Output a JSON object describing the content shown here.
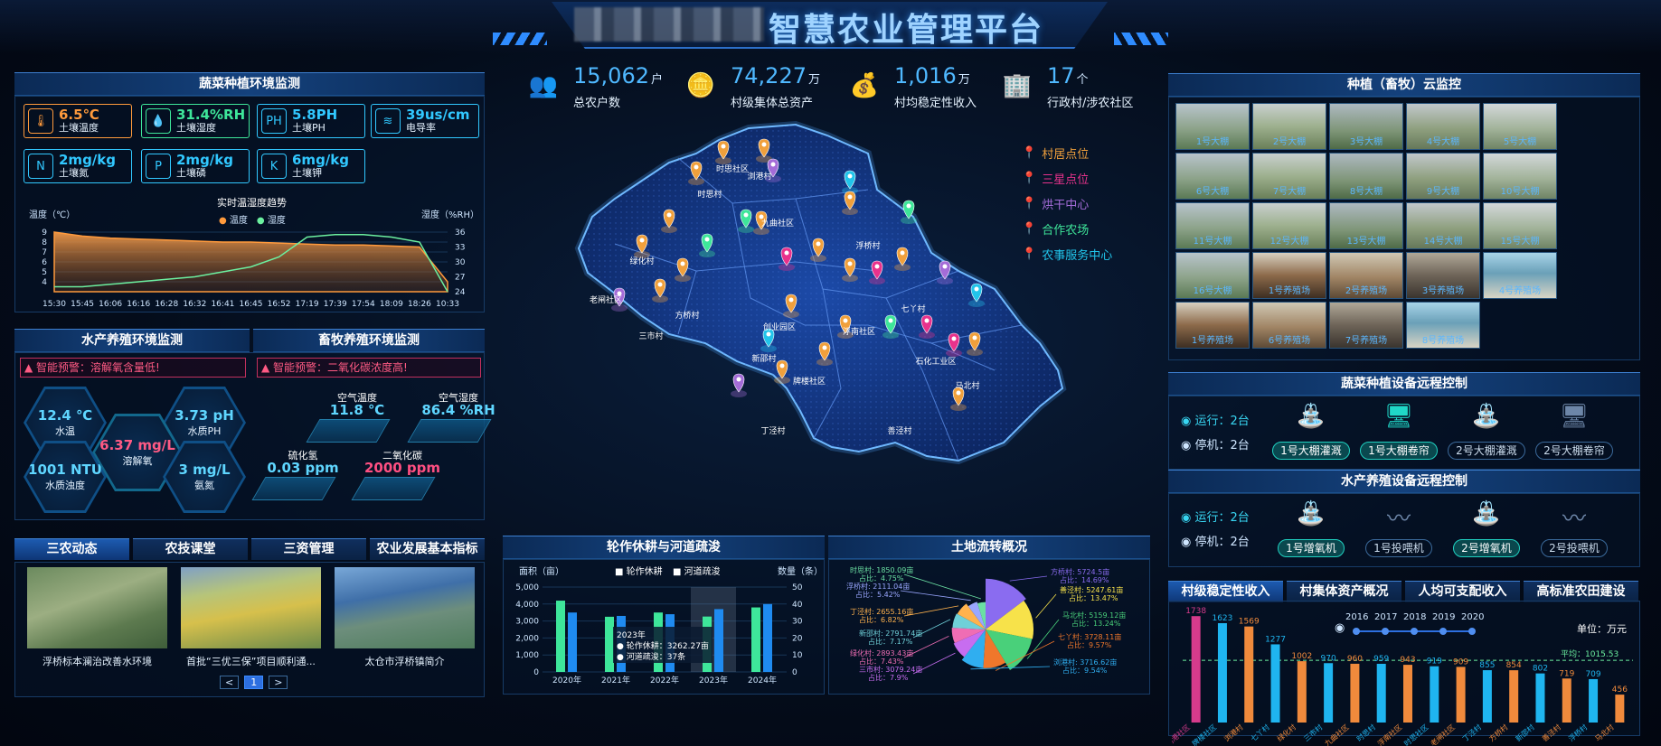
{
  "header": {
    "title": "智慧农业管理平台"
  },
  "stats": [
    {
      "value": "15,062",
      "unit": "户",
      "label": "总农户数",
      "icon": "people-icon",
      "color": "#2d8cf0"
    },
    {
      "value": "74,227",
      "unit": "万",
      "label": "村级集体总资产",
      "icon": "coins-icon",
      "color": "#2d8cf0"
    },
    {
      "value": "1,016",
      "unit": "万",
      "label": "村均稳定性收入",
      "icon": "money-bag-icon",
      "color": "#2d8cf0"
    },
    {
      "value": "17",
      "unit": "个",
      "label": "行政村/涉农社区",
      "icon": "building-icon",
      "color": "#2d8cf0"
    }
  ],
  "veg_env": {
    "title": "蔬菜种植环境监测",
    "sensors": [
      {
        "value": "6.5℃",
        "label": "土壤温度",
        "color": "#ff9a3c"
      },
      {
        "value": "31.4%RH",
        "label": "土壤湿度",
        "color": "#3ee69a"
      },
      {
        "value": "5.8PH",
        "label": "土壤PH",
        "color": "#31c8ff"
      },
      {
        "value": "39us/cm",
        "label": "电导率",
        "color": "#31c8ff"
      },
      {
        "value": "2mg/kg",
        "label": "土壤氮",
        "color": "#31c8ff"
      },
      {
        "value": "2mg/kg",
        "label": "土壤磷",
        "color": "#31c8ff"
      },
      {
        "value": "6mg/kg",
        "label": "土壤钾",
        "color": "#31c8ff"
      }
    ],
    "trend_title": "实时温湿度趋势",
    "temp_axis": "温度（℃）",
    "hum_axis": "湿度（%RH）",
    "legend_temp": "温度",
    "legend_hum": "湿度"
  },
  "aqua_env": {
    "title": "水产养殖环境监测",
    "warning": "智能预警：溶解氧含量低!",
    "items": [
      {
        "value": "12.4 ℃",
        "label": "水温"
      },
      {
        "value": "3.73 pH",
        "label": "水质PH"
      },
      {
        "value": "6.37 mg/L",
        "label": "溶解氧"
      },
      {
        "value": "1001 NTU",
        "label": "水质浊度"
      },
      {
        "value": "3 mg/L",
        "label": "氨氮"
      }
    ]
  },
  "live_env": {
    "title": "畜牧养殖环境监测",
    "warning": "智能预警：二氧化碳浓度高!",
    "items": [
      {
        "label": "空气温度",
        "value": "11.8 ℃"
      },
      {
        "label": "空气湿度",
        "value": "86.4 %RH"
      },
      {
        "label": "硫化氢",
        "value": "0.03 ppm"
      },
      {
        "label": "二氧化碳",
        "value": "2000 ppm"
      }
    ]
  },
  "news": {
    "tabs": [
      "三农动态",
      "农技课堂",
      "三资管理",
      "农业发展基本指标"
    ],
    "items": [
      "浮桥标本澜治改善水环境",
      "首批“三优三保”项目顺利通...",
      "太仓市浮桥镇简介"
    ],
    "pager": {
      "prev": "<",
      "page": "1",
      "next": ">"
    }
  },
  "map": {
    "legend": [
      {
        "label": "村居点位",
        "color": "#f0a03c"
      },
      {
        "label": "三星点位",
        "color": "#e8328c"
      },
      {
        "label": "烘干中心",
        "color": "#a46cd8"
      },
      {
        "label": "合作农场",
        "color": "#3ee69a"
      },
      {
        "label": "农事服务中心",
        "color": "#21c4ea"
      }
    ],
    "places": [
      "浏港村",
      "时思社区",
      "时思村",
      "九曲社区",
      "浮桥村",
      "绿化村",
      "老闸社区",
      "方桥村",
      "三市村",
      "创业园区",
      "浮南社区",
      "七丫村",
      "石化工业区",
      "新邵村",
      "牌楼社区",
      "马北村",
      "丁泾村",
      "善泾村"
    ]
  },
  "monitor": {
    "title": "种植（畜牧）云监控",
    "cams": [
      "1号大棚",
      "2号大棚",
      "3号大棚",
      "4号大棚",
      "5号大棚",
      "6号大棚",
      "7号大棚",
      "8号大棚",
      "9号大棚",
      "10号大棚",
      "11号大棚",
      "12号大棚",
      "13号大棚",
      "14号大棚",
      "15号大棚",
      "16号大棚",
      "1号养殖场",
      "2号养殖场",
      "3号养殖场",
      "4号养殖场",
      "1号养殖场",
      "6号养殖场",
      "7号养殖场",
      "8号养殖场"
    ]
  },
  "veg_ctrl": {
    "title": "蔬菜种植设备远程控制",
    "running": "运行：2台",
    "stopped": "停机：2台",
    "devices": [
      "1号大棚灌溉",
      "1号大棚卷帘",
      "2号大棚灌溉",
      "2号大棚卷帘"
    ]
  },
  "aqua_ctrl": {
    "title": "水产养殖设备远程控制",
    "running": "运行：2台",
    "stopped": "停机：2台",
    "devices": [
      "1号增氧机",
      "1号投喂机",
      "2号增氧机",
      "2号投喂机"
    ]
  },
  "rotation": {
    "title": "轮作休耕与河道疏浚",
    "left_axis": "面积（亩）",
    "right_axis": "数量（条）",
    "legend1": "轮作休耕",
    "legend2": "河道疏浚",
    "tip_year": "2023年",
    "tip1": "● 轮作休耕：3262.27亩",
    "tip2": "● 河道疏浚：37条"
  },
  "land": {
    "title": "土地流转概况"
  },
  "income": {
    "tabs": [
      "村级稳定性收入",
      "村集体资产概况",
      "人均可支配收入",
      "高标准农田建设"
    ],
    "unit": "单位：万元",
    "avg": "平均：1015.53",
    "years": [
      "2016",
      "2017",
      "2018",
      "2019",
      "2020"
    ]
  },
  "chart_data": [
    {
      "type": "area",
      "title": "实时温湿度趋势",
      "x": [
        "15:30",
        "15:45",
        "16:06",
        "16:16",
        "16:28",
        "16:32",
        "16:41",
        "16:45",
        "16:52",
        "17:19",
        "17:39",
        "17:54",
        "18:09",
        "18:26",
        "10:33"
      ],
      "series": [
        {
          "name": "温度",
          "values": [
            9,
            8.6,
            8.4,
            8.3,
            8.2,
            8.1,
            8,
            8,
            7.9,
            7.8,
            7.7,
            7.7,
            7.6,
            7.5,
            4
          ]
        },
        {
          "name": "湿度",
          "values": [
            25,
            25,
            25.5,
            26,
            26.5,
            27,
            28,
            29,
            31,
            35,
            35.5,
            35.5,
            35,
            34,
            24
          ]
        }
      ],
      "ylim": [
        3,
        9
      ],
      "ylim2": [
        24,
        36
      ]
    },
    {
      "type": "bar",
      "title": "轮作休耕与河道疏浚",
      "categories": [
        "2020年",
        "2021年",
        "2022年",
        "2023年",
        "2024年"
      ],
      "series": [
        {
          "name": "轮作休耕",
          "values": [
            4200,
            3250,
            3500,
            3262.27,
            3800
          ]
        },
        {
          "name": "河道疏浚",
          "values": [
            35,
            33,
            34,
            37,
            40
          ]
        }
      ],
      "ylim": [
        0,
        5000
      ],
      "ylim2": [
        0,
        50
      ]
    },
    {
      "type": "pie",
      "title": "土地流转概况",
      "slices": [
        {
          "label": "方桥村: 5724.5亩",
          "pct": "占比：14.69%",
          "value": 14.69,
          "color": "#8a6cf0"
        },
        {
          "label": "善泾村: 5247.61亩",
          "pct": "占比：13.47%",
          "value": 13.47,
          "color": "#f7e24a"
        },
        {
          "label": "马北村: 5159.12亩",
          "pct": "占比：13.24%",
          "value": 13.24,
          "color": "#49d07a"
        },
        {
          "label": "七丫村: 3728.11亩",
          "pct": "占比：9.57%",
          "value": 9.57,
          "color": "#f0772b"
        },
        {
          "label": "浏港村: 3716.62亩",
          "pct": "占比：9.54%",
          "value": 9.54,
          "color": "#30aef0"
        },
        {
          "label": "三市村: 3079.24亩",
          "pct": "占比：7.9%",
          "value": 7.9,
          "color": "#c76df0"
        },
        {
          "label": "绿化村: 2893.43亩",
          "pct": "占比：7.43%",
          "value": 7.43,
          "color": "#ef6db4"
        },
        {
          "label": "新邵村: 2791.74亩",
          "pct": "占比：7.17%",
          "value": 7.17,
          "color": "#6fd0d8"
        },
        {
          "label": "丁泾村: 2655.16亩",
          "pct": "占比：6.82%",
          "value": 6.82,
          "color": "#ffb24d"
        },
        {
          "label": "浮桥村: 2111.04亩",
          "pct": "占比：5.42%",
          "value": 5.42,
          "color": "#9aa7ff"
        },
        {
          "label": "时思村: 1850.09亩",
          "pct": "占比：4.75%",
          "value": 4.75,
          "color": "#6be0a3"
        }
      ]
    },
    {
      "type": "bar",
      "title": "村级稳定性收入",
      "categories": [
        "浏港社区",
        "牌楼社区",
        "浏港村",
        "七丫村",
        "绿化村",
        "三市村",
        "九曲社区",
        "时思村",
        "浮南社区",
        "时思社区",
        "老闸社区",
        "丁泾村",
        "方桥村",
        "新邵村",
        "善泾村",
        "浮桥村",
        "马北村"
      ],
      "values": [
        1738,
        1623,
        1569,
        1277,
        1002,
        970,
        960,
        959,
        943,
        919,
        909,
        855,
        854,
        802,
        719,
        709,
        456
      ],
      "colors": [
        "#d63b8c",
        "#1fb5f0",
        "#f08a3c",
        "#1fb5f0",
        "#f08a3c",
        "#1fb5f0",
        "#f08a3c",
        "#1fb5f0",
        "#f08a3c",
        "#1fb5f0",
        "#f08a3c",
        "#1fb5f0",
        "#f08a3c",
        "#1fb5f0",
        "#f08a3c",
        "#1fb5f0",
        "#f08a3c"
      ],
      "avg": 1015.53,
      "ylim": [
        0,
        1800
      ]
    }
  ]
}
